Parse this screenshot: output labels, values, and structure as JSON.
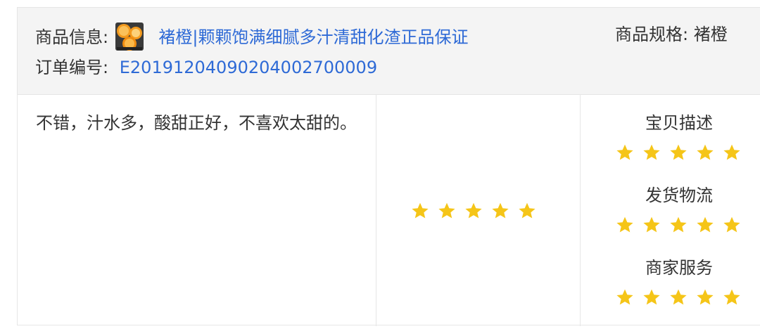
{
  "header": {
    "product_info_label": "商品信息:",
    "product_name": "褚橙|颗颗饱满细腻多汁清甜化渣正品保证",
    "product_spec_label": "商品规格:",
    "product_spec_value": "褚橙",
    "order_no_label": "订单编号:",
    "order_no": "E20191204090204002700009",
    "thumbnail": "orange-fruit-thumbnail"
  },
  "review": {
    "comment": "不错，汁水多，酸甜正好，不喜欢太甜的。",
    "overall_rating": 5,
    "scores": [
      {
        "label": "宝贝描述",
        "rating": 5
      },
      {
        "label": "发货物流",
        "rating": 5
      },
      {
        "label": "商家服务",
        "rating": 5
      }
    ]
  },
  "colors": {
    "star": "#f5c518",
    "link": "#2e6ad6",
    "header_bg": "#f4f4f4",
    "border": "#e6e6e6",
    "text": "#333333"
  },
  "icons": {
    "rating_star": "star-icon"
  }
}
